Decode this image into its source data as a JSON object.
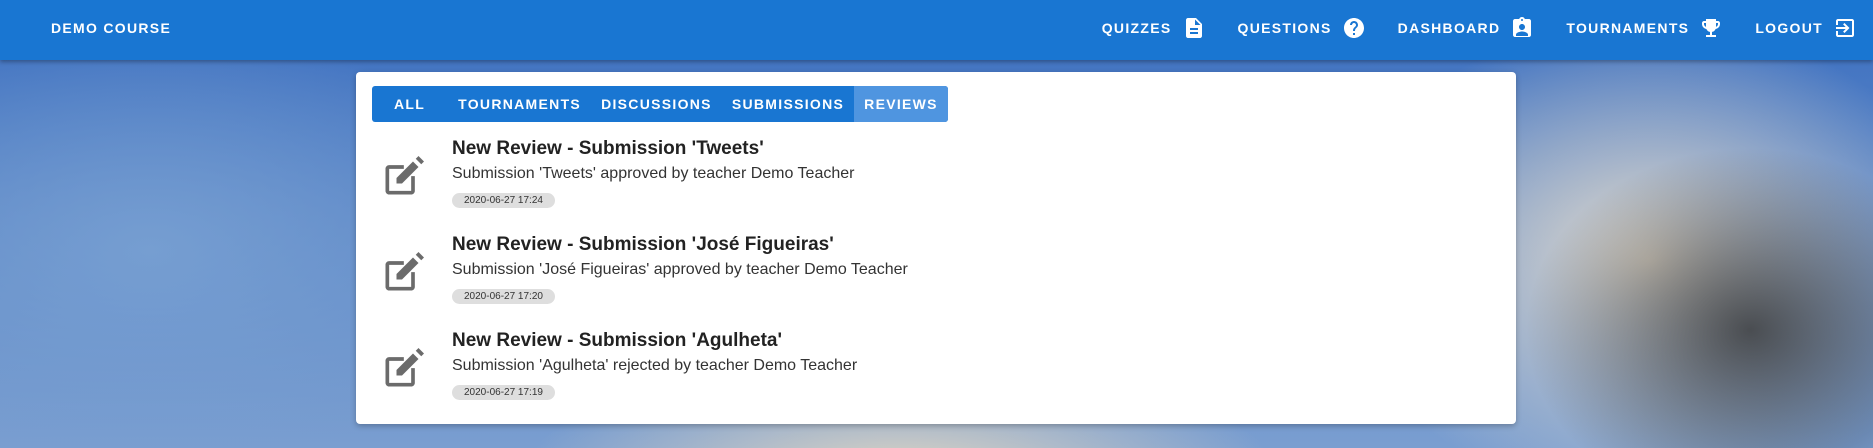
{
  "app": {
    "course_name": "DEMO COURSE"
  },
  "nav": [
    {
      "label": "QUIZZES",
      "icon": "file-document-icon"
    },
    {
      "label": "QUESTIONS",
      "icon": "help-circle-icon"
    },
    {
      "label": "DASHBOARD",
      "icon": "account-box-icon"
    },
    {
      "label": "TOURNAMENTS",
      "icon": "trophy-icon"
    },
    {
      "label": "LOGOUT",
      "icon": "logout-icon"
    }
  ],
  "tabs": [
    {
      "label": "ALL"
    },
    {
      "label": "TOURNAMENTS"
    },
    {
      "label": "DISCUSSIONS"
    },
    {
      "label": "SUBMISSIONS"
    },
    {
      "label": "REVIEWS",
      "active": true
    }
  ],
  "notifications": [
    {
      "title": "New Review - Submission 'Tweets'",
      "description": "Submission 'Tweets' approved by teacher Demo Teacher",
      "timestamp": "2020-06-27 17:24",
      "icon": "edit-icon"
    },
    {
      "title": "New Review - Submission 'José Figueiras'",
      "description": "Submission 'José Figueiras' approved by teacher Demo Teacher",
      "timestamp": "2020-06-27 17:20",
      "icon": "edit-icon"
    },
    {
      "title": "New Review - Submission 'Agulheta'",
      "description": "Submission 'Agulheta' rejected by teacher Demo Teacher",
      "timestamp": "2020-06-27 17:19",
      "icon": "edit-icon"
    }
  ],
  "colors": {
    "primary": "#1976d2",
    "active_tab": "#4f95e0",
    "icon_gray": "#6b6b6b"
  }
}
